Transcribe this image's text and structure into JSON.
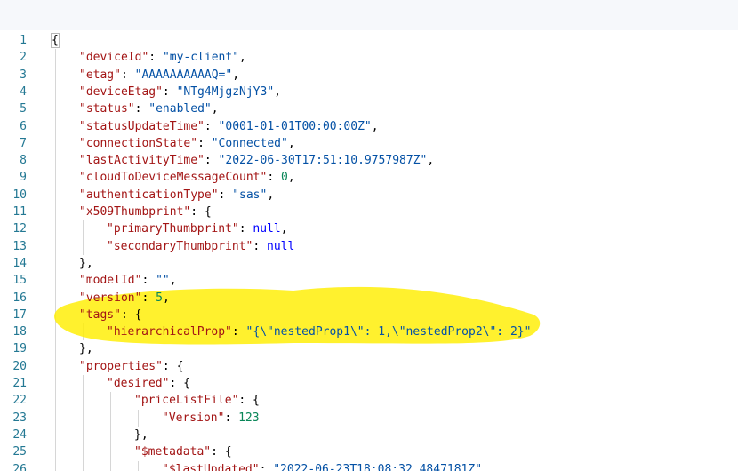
{
  "editor": {
    "lines": [
      {
        "n": "1",
        "i": 0,
        "parts": [
          [
            "p",
            "{"
          ]
        ]
      },
      {
        "n": "2",
        "i": 1,
        "parts": [
          [
            "k",
            "\"deviceId\""
          ],
          [
            "p",
            ": "
          ],
          [
            "s",
            "\"my-client\""
          ],
          [
            "p",
            ","
          ]
        ]
      },
      {
        "n": "3",
        "i": 1,
        "parts": [
          [
            "k",
            "\"etag\""
          ],
          [
            "p",
            ": "
          ],
          [
            "s",
            "\"AAAAAAAAAAQ=\""
          ],
          [
            "p",
            ","
          ]
        ]
      },
      {
        "n": "4",
        "i": 1,
        "parts": [
          [
            "k",
            "\"deviceEtag\""
          ],
          [
            "p",
            ": "
          ],
          [
            "s",
            "\"NTg4MjgzNjY3\""
          ],
          [
            "p",
            ","
          ]
        ]
      },
      {
        "n": "5",
        "i": 1,
        "parts": [
          [
            "k",
            "\"status\""
          ],
          [
            "p",
            ": "
          ],
          [
            "s",
            "\"enabled\""
          ],
          [
            "p",
            ","
          ]
        ]
      },
      {
        "n": "6",
        "i": 1,
        "parts": [
          [
            "k",
            "\"statusUpdateTime\""
          ],
          [
            "p",
            ": "
          ],
          [
            "s",
            "\"0001-01-01T00:00:00Z\""
          ],
          [
            "p",
            ","
          ]
        ]
      },
      {
        "n": "7",
        "i": 1,
        "parts": [
          [
            "k",
            "\"connectionState\""
          ],
          [
            "p",
            ": "
          ],
          [
            "s",
            "\"Connected\""
          ],
          [
            "p",
            ","
          ]
        ]
      },
      {
        "n": "8",
        "i": 1,
        "parts": [
          [
            "k",
            "\"lastActivityTime\""
          ],
          [
            "p",
            ": "
          ],
          [
            "s",
            "\"2022-06-30T17:51:10.9757987Z\""
          ],
          [
            "p",
            ","
          ]
        ]
      },
      {
        "n": "9",
        "i": 1,
        "parts": [
          [
            "k",
            "\"cloudToDeviceMessageCount\""
          ],
          [
            "p",
            ": "
          ],
          [
            "n",
            "0"
          ],
          [
            "p",
            ","
          ]
        ]
      },
      {
        "n": "10",
        "i": 1,
        "parts": [
          [
            "k",
            "\"authenticationType\""
          ],
          [
            "p",
            ": "
          ],
          [
            "s",
            "\"sas\""
          ],
          [
            "p",
            ","
          ]
        ]
      },
      {
        "n": "11",
        "i": 1,
        "parts": [
          [
            "k",
            "\"x509Thumbprint\""
          ],
          [
            "p",
            ": {"
          ]
        ]
      },
      {
        "n": "12",
        "i": 2,
        "parts": [
          [
            "k",
            "\"primaryThumbprint\""
          ],
          [
            "p",
            ": "
          ],
          [
            "b",
            "null"
          ],
          [
            "p",
            ","
          ]
        ]
      },
      {
        "n": "13",
        "i": 2,
        "parts": [
          [
            "k",
            "\"secondaryThumbprint\""
          ],
          [
            "p",
            ": "
          ],
          [
            "b",
            "null"
          ]
        ]
      },
      {
        "n": "14",
        "i": 1,
        "parts": [
          [
            "p",
            "},"
          ]
        ]
      },
      {
        "n": "15",
        "i": 1,
        "parts": [
          [
            "k",
            "\"modelId\""
          ],
          [
            "p",
            ": "
          ],
          [
            "s",
            "\"\""
          ],
          [
            "p",
            ","
          ]
        ]
      },
      {
        "n": "16",
        "i": 1,
        "parts": [
          [
            "k",
            "\"version\""
          ],
          [
            "p",
            ": "
          ],
          [
            "n",
            "5"
          ],
          [
            "p",
            ","
          ]
        ]
      },
      {
        "n": "17",
        "i": 1,
        "parts": [
          [
            "k",
            "\"tags\""
          ],
          [
            "p",
            ": {"
          ]
        ]
      },
      {
        "n": "18",
        "i": 2,
        "parts": [
          [
            "k",
            "\"hierarchicalProp\""
          ],
          [
            "p",
            ": "
          ],
          [
            "s",
            "\"{\\\"nestedProp1\\\": 1,\\\"nestedProp2\\\": 2}\""
          ]
        ]
      },
      {
        "n": "19",
        "i": 1,
        "parts": [
          [
            "p",
            "},"
          ]
        ]
      },
      {
        "n": "20",
        "i": 1,
        "parts": [
          [
            "k",
            "\"properties\""
          ],
          [
            "p",
            ": {"
          ]
        ]
      },
      {
        "n": "21",
        "i": 2,
        "parts": [
          [
            "k",
            "\"desired\""
          ],
          [
            "p",
            ": {"
          ]
        ]
      },
      {
        "n": "22",
        "i": 3,
        "parts": [
          [
            "k",
            "\"priceListFile\""
          ],
          [
            "p",
            ": {"
          ]
        ]
      },
      {
        "n": "23",
        "i": 4,
        "parts": [
          [
            "k",
            "\"Version\""
          ],
          [
            "p",
            ": "
          ],
          [
            "n",
            "123"
          ]
        ]
      },
      {
        "n": "24",
        "i": 3,
        "parts": [
          [
            "p",
            "},"
          ]
        ]
      },
      {
        "n": "25",
        "i": 3,
        "parts": [
          [
            "k",
            "\"$metadata\""
          ],
          [
            "p",
            ": {"
          ]
        ]
      },
      {
        "n": "26",
        "i": 4,
        "parts": [
          [
            "k",
            "\"$lastUpdated\""
          ],
          [
            "p",
            ": "
          ],
          [
            "s",
            "\"2022-06-23T18:08:32.4847181Z\""
          ],
          [
            "p",
            ","
          ]
        ]
      }
    ]
  },
  "colors": {
    "line_number": "#237893",
    "property_key": "#a31515",
    "string_value": "#0451a5",
    "number_value": "#098658",
    "keyword_value": "#0000ff",
    "highlight": "#ffee00"
  }
}
